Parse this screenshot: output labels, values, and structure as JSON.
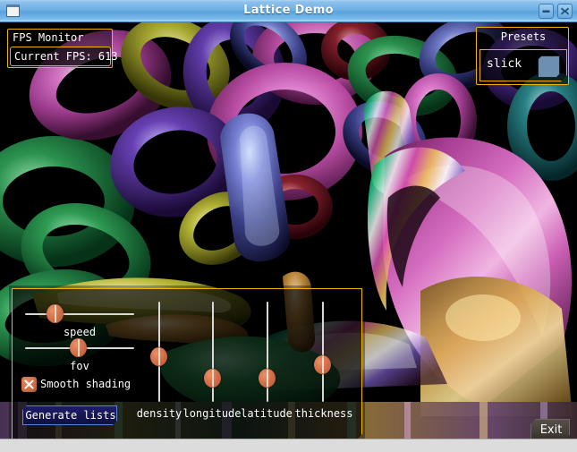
{
  "window": {
    "title": "Lattice Demo",
    "icon": "app-window-icon",
    "buttons": {
      "minimize": "minimize-icon",
      "close": "close-icon"
    }
  },
  "fps_monitor": {
    "title": "FPS Monitor",
    "current": "Current FPS: 613",
    "border_color": "#f0b400"
  },
  "presets": {
    "title": "Presets",
    "selected": "slick",
    "swatch_color": "#6d8fb0",
    "border_color": "#f0b400"
  },
  "controls": {
    "border_color": "#f0b400",
    "handle_color": "#d4714a",
    "track_color": "#d8d8d8",
    "h_sliders": [
      {
        "label": "speed",
        "value_pct": 33
      },
      {
        "label": "fov",
        "value_pct": 54
      }
    ],
    "v_sliders": [
      {
        "label": "density",
        "value_pct": 52
      },
      {
        "label": "longitude",
        "value_pct": 28
      },
      {
        "label": "latitude",
        "value_pct": 28
      },
      {
        "label": "thickness",
        "value_pct": 42
      }
    ],
    "smooth_shading": {
      "label": "Smooth shading",
      "checked": true,
      "mark": "x-mark-icon"
    },
    "generate_button": "Generate lists"
  },
  "exit_button": {
    "label": "Exit"
  },
  "scene": {
    "background": "#000000",
    "description": "lattice of shaded tori"
  }
}
